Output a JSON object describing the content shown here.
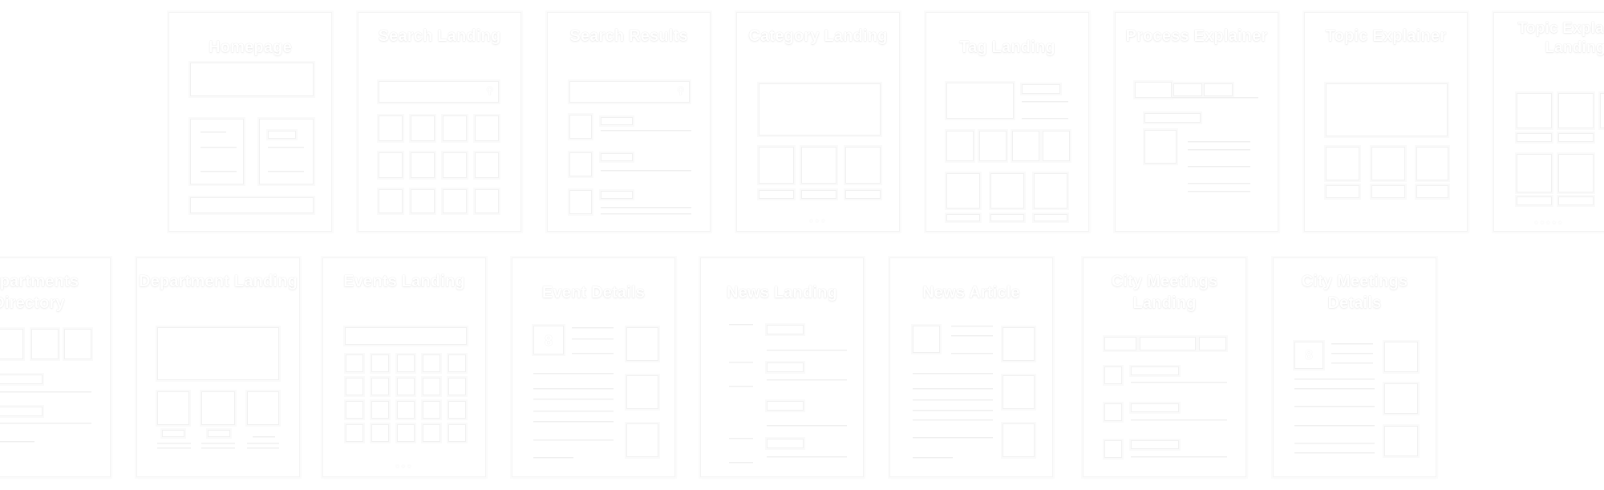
{
  "diagram": {
    "type": "page-template-thumbnails",
    "rows": [
      {
        "cards": [
          {
            "id": "homepage",
            "title": "Homepage"
          },
          {
            "id": "search-landing",
            "title": "Search Landing"
          },
          {
            "id": "search-results",
            "title": "Search Results"
          },
          {
            "id": "category-landing",
            "title": "Category Landing"
          },
          {
            "id": "tag-landing",
            "title": "Tag Landing"
          },
          {
            "id": "process-explainer",
            "title": "Process Explainer"
          },
          {
            "id": "topic-explainer",
            "title": "Topic Explainer"
          },
          {
            "id": "topic-explainer-landing",
            "title": "Topic Explainer Landing"
          }
        ]
      },
      {
        "cards": [
          {
            "id": "departments-directory",
            "title": "Departments Directory"
          },
          {
            "id": "department-landing",
            "title": "Department Landing"
          },
          {
            "id": "events-landing",
            "title": "Events Landing"
          },
          {
            "id": "event-details",
            "title": "Event Details"
          },
          {
            "id": "news-landing",
            "title": "News Landing"
          },
          {
            "id": "news-article",
            "title": "News Article"
          },
          {
            "id": "city-meetings-landing",
            "title": "City Meetings Landing"
          },
          {
            "id": "city-meetings-details",
            "title": "City Meetings Details"
          }
        ]
      }
    ],
    "icons": {
      "search": "search-icon",
      "calendar_day": "8",
      "pagination": "pagination-dots"
    },
    "colors": {
      "background": "#ffffff",
      "card_fill": "#ffffff",
      "outline": "#f1f1f1"
    }
  }
}
